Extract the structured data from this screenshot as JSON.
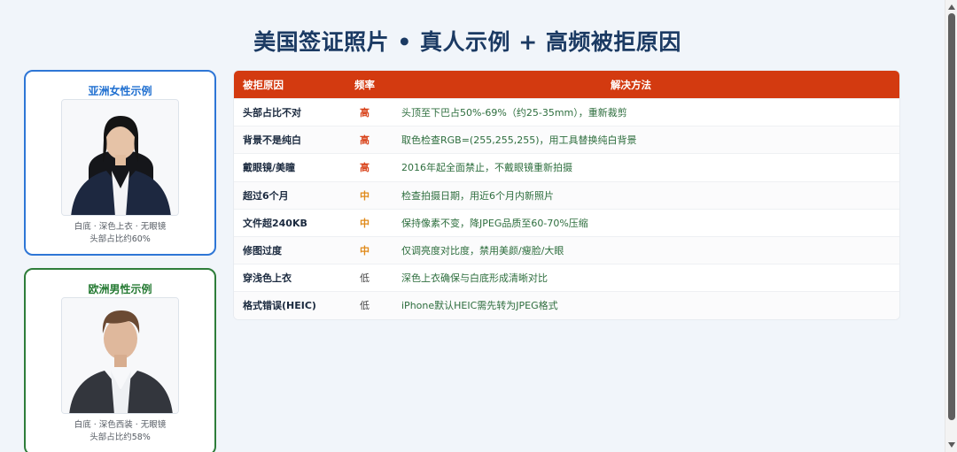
{
  "title": "美国签证照片 • 真人示例 + 高频被拒原因",
  "samples": [
    {
      "title": "亚洲女性示例",
      "caption_line1": "白底 · 深色上衣 · 无眼镜",
      "caption_line2": "头部占比约60%"
    },
    {
      "title": "欧洲男性示例",
      "caption_line1": "白底 · 深色西装 · 无眼镜",
      "caption_line2": "头部占比约58%"
    }
  ],
  "table": {
    "headers": [
      "被拒原因",
      "频率",
      "解决方法"
    ],
    "rows": [
      {
        "reason": "头部占比不对",
        "freq": "高",
        "fix": "头顶至下巴占50%-69%（约25-35mm），重新裁剪"
      },
      {
        "reason": "背景不是纯白",
        "freq": "高",
        "fix": "取色检查RGB=(255,255,255)，用工具替换纯白背景"
      },
      {
        "reason": "戴眼镜/美瞳",
        "freq": "高",
        "fix": "2016年起全面禁止，不戴眼镜重新拍摄"
      },
      {
        "reason": "超过6个月",
        "freq": "中",
        "fix": "检查拍摄日期，用近6个月内新照片"
      },
      {
        "reason": "文件超240KB",
        "freq": "中",
        "fix": "保持像素不变，降JPEG品质至60-70%压缩"
      },
      {
        "reason": "修图过度",
        "freq": "中",
        "fix": "仅调亮度对比度，禁用美颜/瘦脸/大眼"
      },
      {
        "reason": "穿浅色上衣",
        "freq": "低",
        "fix": "深色上衣确保与白底形成清晰对比"
      },
      {
        "reason": "格式错误(HEIC)",
        "freq": "低",
        "fix": "iPhone默认HEIC需先转为JPEG格式"
      }
    ]
  },
  "colors": {
    "header_bg": "#d33a10",
    "title": "#1b3a63",
    "asian_border": "#2e76d6",
    "euro_border": "#2e7d3a",
    "freq_high": "#d9441c",
    "freq_mid": "#e08a1a",
    "freq_low": "#444444"
  }
}
